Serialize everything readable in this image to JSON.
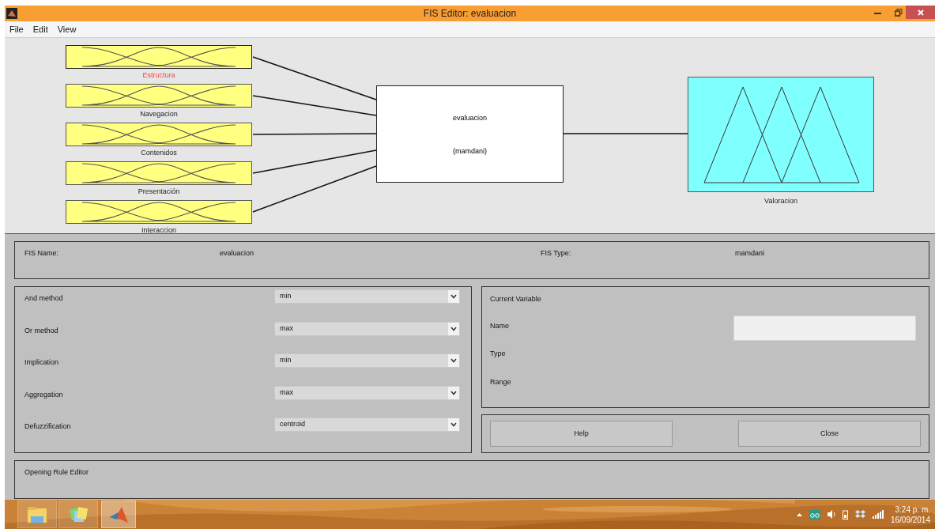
{
  "window": {
    "title": "FIS Editor: evaluacion"
  },
  "menu": [
    "File",
    "Edit",
    "View"
  ],
  "inputs": [
    {
      "name": "Estructura",
      "selected": true
    },
    {
      "name": "Navegacion",
      "selected": false
    },
    {
      "name": "Contenidos",
      "selected": false
    },
    {
      "name": "Presentación",
      "selected": false
    },
    {
      "name": "Interaccion",
      "selected": false
    }
  ],
  "system": {
    "name": "evaluacion",
    "type": "(mamdani)"
  },
  "output": {
    "name": "Valoracion",
    "selected": false
  },
  "fis_info": {
    "name_label": "FIS Name:",
    "name_value": "evaluacion",
    "type_label": "FIS Type:",
    "type_value": "mamdani"
  },
  "methods": [
    {
      "label": "And method",
      "value": "min"
    },
    {
      "label": "Or method",
      "value": "max"
    },
    {
      "label": "Implication",
      "value": "min"
    },
    {
      "label": "Aggregation",
      "value": "max"
    },
    {
      "label": "Defuzzification",
      "value": "centroid"
    }
  ],
  "current_variable": {
    "title": "Current Variable",
    "fields": [
      {
        "label": "Name",
        "kind": "input"
      },
      {
        "label": "Type",
        "kind": "text"
      },
      {
        "label": "Range",
        "kind": "text"
      }
    ]
  },
  "buttons": [
    "Help",
    "Close"
  ],
  "status": "Opening Rule Editor",
  "taskbar": {
    "time": "3:24 p. m.",
    "date": "16/09/2014"
  }
}
